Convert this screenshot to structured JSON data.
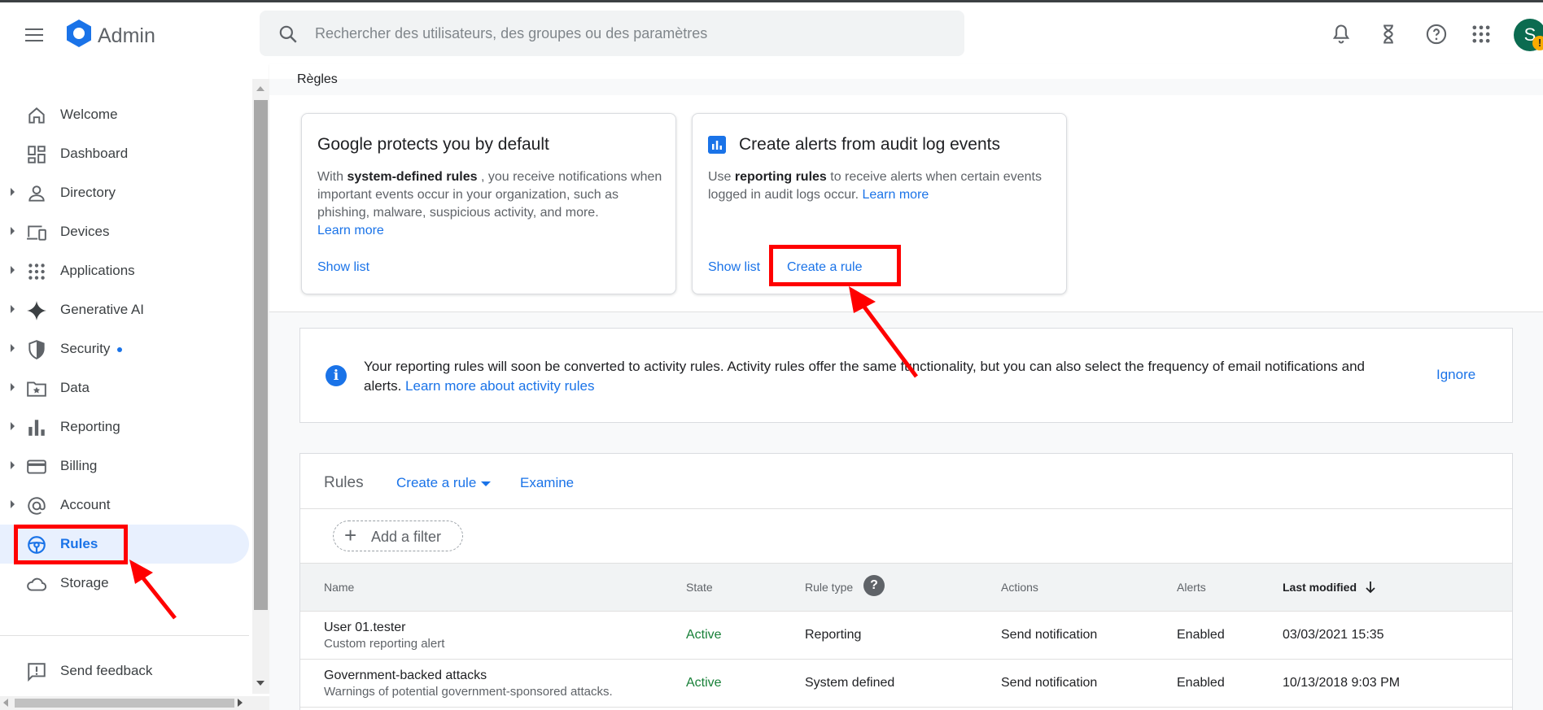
{
  "header": {
    "app_name": "Admin",
    "search_placeholder": "Rechercher des utilisateurs, des groupes ou des paramètres",
    "avatar_letter": "S",
    "avatar_badge": "!"
  },
  "breadcrumb": "Règles",
  "sidebar": {
    "items": [
      {
        "label": "Welcome",
        "icon": "home-icon"
      },
      {
        "label": "Dashboard",
        "icon": "dashboard-icon"
      },
      {
        "label": "Directory",
        "icon": "person-icon"
      },
      {
        "label": "Devices",
        "icon": "devices-icon"
      },
      {
        "label": "Applications",
        "icon": "apps-grid-icon"
      },
      {
        "label": "Generative AI",
        "icon": "sparkle-icon"
      },
      {
        "label": "Security",
        "icon": "shield-icon"
      },
      {
        "label": "Data",
        "icon": "folder-star-icon"
      },
      {
        "label": "Reporting",
        "icon": "bar-chart-icon"
      },
      {
        "label": "Billing",
        "icon": "credit-card-icon"
      },
      {
        "label": "Account",
        "icon": "at-sign-icon"
      },
      {
        "label": "Rules",
        "icon": "steering-wheel-icon"
      },
      {
        "label": "Storage",
        "icon": "cloud-icon"
      }
    ],
    "feedback": "Send feedback"
  },
  "cards": {
    "protect": {
      "title": "Google protects you by default",
      "body_pre": "With ",
      "body_bold": "system-defined rules",
      "body_post": " , you receive notifications when important events occur in your organization, such as phishing, malware, suspicious activity, and more.",
      "learn_more": "Learn more",
      "show_list": "Show list"
    },
    "alerts": {
      "title": "Create alerts from audit log events",
      "body_pre": "Use ",
      "body_bold": "reporting rules",
      "body_post": " to receive alerts when certain events logged in audit logs occur. ",
      "learn_more": "Learn more",
      "show_list": "Show list",
      "create_rule": "Create a rule"
    }
  },
  "banner": {
    "text": "Your reporting rules will soon be converted to activity rules. Activity rules offer the same functionality, but you can also select the frequency of email notifications and alerts. ",
    "link": "Learn more about activity rules",
    "ignore": "Ignore"
  },
  "rules": {
    "title": "Rules",
    "create_rule": "Create a rule",
    "examine": "Examine",
    "add_filter": "Add a filter",
    "columns": {
      "name": "Name",
      "state": "State",
      "rule_type": "Rule type",
      "actions": "Actions",
      "alerts": "Alerts",
      "last_modified": "Last modified"
    },
    "rows": [
      {
        "name": "User 01.tester",
        "desc": "Custom reporting alert",
        "state": "Active",
        "rule_type": "Reporting",
        "actions": "Send notification",
        "alerts": "Enabled",
        "last_modified": "03/03/2021 15:35"
      },
      {
        "name": "Government-backed attacks",
        "desc": "Warnings of potential government-sponsored attacks.",
        "state": "Active",
        "rule_type": "System defined",
        "actions": "Send notification",
        "alerts": "Enabled",
        "last_modified": "10/13/2018 9:03 PM"
      }
    ]
  },
  "colors": {
    "accent": "#1a73e8",
    "active_state": "#188038",
    "annotation": "#ff0000"
  }
}
